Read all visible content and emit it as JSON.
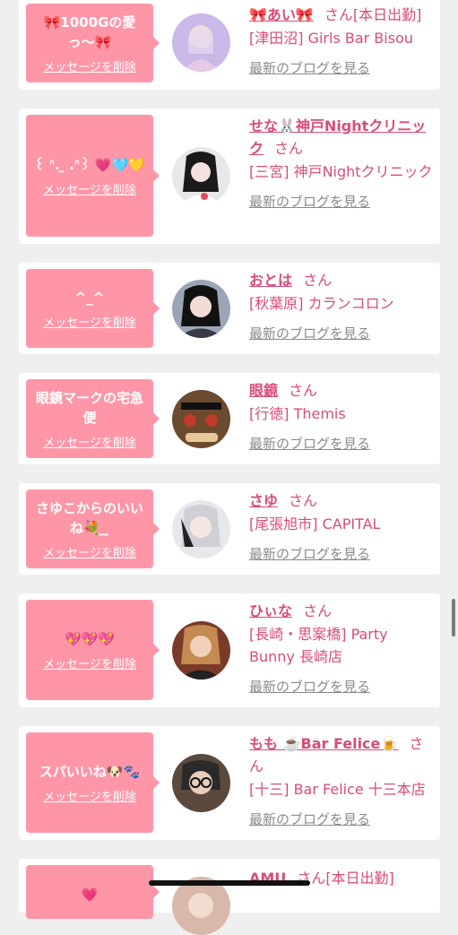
{
  "delete_label": "メッセージを削除",
  "blog_label": "最新のブログを見る",
  "san_label": "さん",
  "cards": [
    {
      "message": "🎀1000Gの愛っ〜🎀",
      "name": "🎀あい🎀",
      "extra": "[本日出勤]",
      "shop": "[津田沼] Girls Bar Bisou"
    },
    {
      "message": "꒰ ᐢ. ̫ .ᐢ꒱ 💗🩵💛",
      "name": "せな🐰神戸Nightクリニック",
      "extra": "",
      "shop": "[三宮] 神戸Nightクリニック"
    },
    {
      "message": "^_^",
      "name": "おとは",
      "extra": "",
      "shop": "[秋葉原] カランコロン"
    },
    {
      "message": "眼鏡マークの宅急便",
      "name": "眼鏡",
      "extra": "",
      "shop": "[行徳] Themis"
    },
    {
      "message": "さゆこからのいいね💐 ̫ ̫",
      "name": "さゆ",
      "extra": "",
      "shop": "[尾張旭市] CAPITAL"
    },
    {
      "message": "💖💖💖",
      "name": "ひぃな",
      "extra": "",
      "shop": "[長崎・思案橋] Party Bunny 長崎店"
    },
    {
      "message": "スパいいね🐶🐾",
      "name": "もも ☕️Bar Felice🍺",
      "extra": "",
      "shop": "[十三] Bar Felice 十三本店"
    },
    {
      "message": "💗",
      "name": "AMU",
      "extra": "[本日出勤]",
      "shop": ""
    }
  ]
}
